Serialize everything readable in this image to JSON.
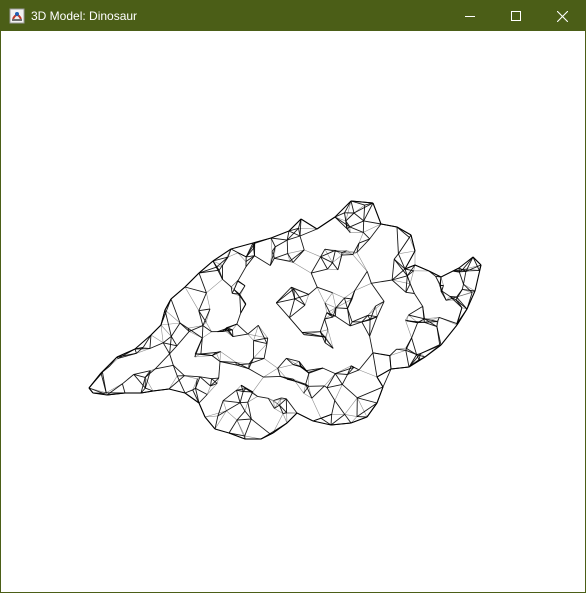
{
  "window": {
    "title": "3D Model: Dinosaur",
    "titlebar_color": "#4b5e17",
    "title_color": "#ffffff",
    "icons": {
      "app": "java-app-icon",
      "minimize": "minimize-icon",
      "maximize": "maximize-icon",
      "close": "close-icon"
    }
  },
  "viewport": {
    "background": "#ffffff",
    "model": "dinosaur-wireframe",
    "stroke_color": "#000000"
  }
}
